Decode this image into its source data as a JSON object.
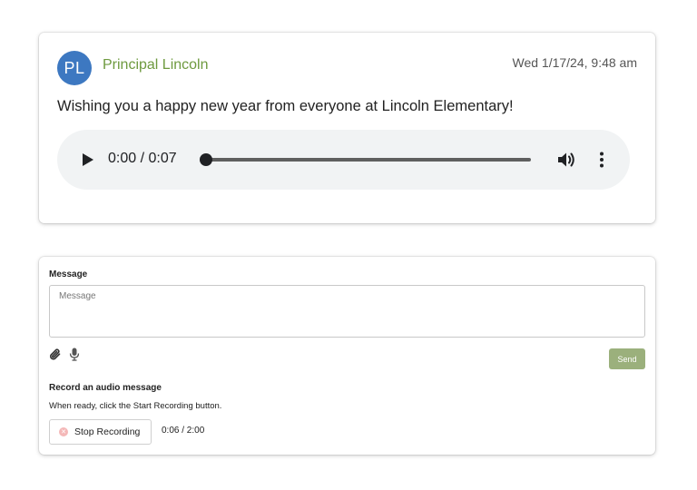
{
  "post": {
    "avatar_initials": "PL",
    "author": "Principal Lincoln",
    "timestamp": "Wed 1/17/24, 9:48 am",
    "text": "Wishing you a happy new year from everyone at Lincoln Elementary!",
    "audio": {
      "time": "0:00 / 0:07",
      "progress": 0
    }
  },
  "composer": {
    "message_label": "Message",
    "message_placeholder": "Message",
    "message_value": "",
    "send_label": "Send",
    "record_heading": "Record an audio message",
    "record_instructions": "When ready, click the Start Recording button.",
    "stop_label": "Stop Recording",
    "record_timer": "0:06 / 2:00"
  },
  "colors": {
    "avatar_bg": "#3d78c1",
    "author_text": "#6e9a3f",
    "send_bg": "#9bb07c",
    "stop_icon": "#f4b8b8",
    "player_bg": "#f1f3f4"
  },
  "icons": {
    "play": "play-icon",
    "volume": "volume-icon",
    "more": "more-vertical-icon",
    "attach": "paperclip-icon",
    "mic": "microphone-icon",
    "stop": "stop-circle-icon"
  }
}
